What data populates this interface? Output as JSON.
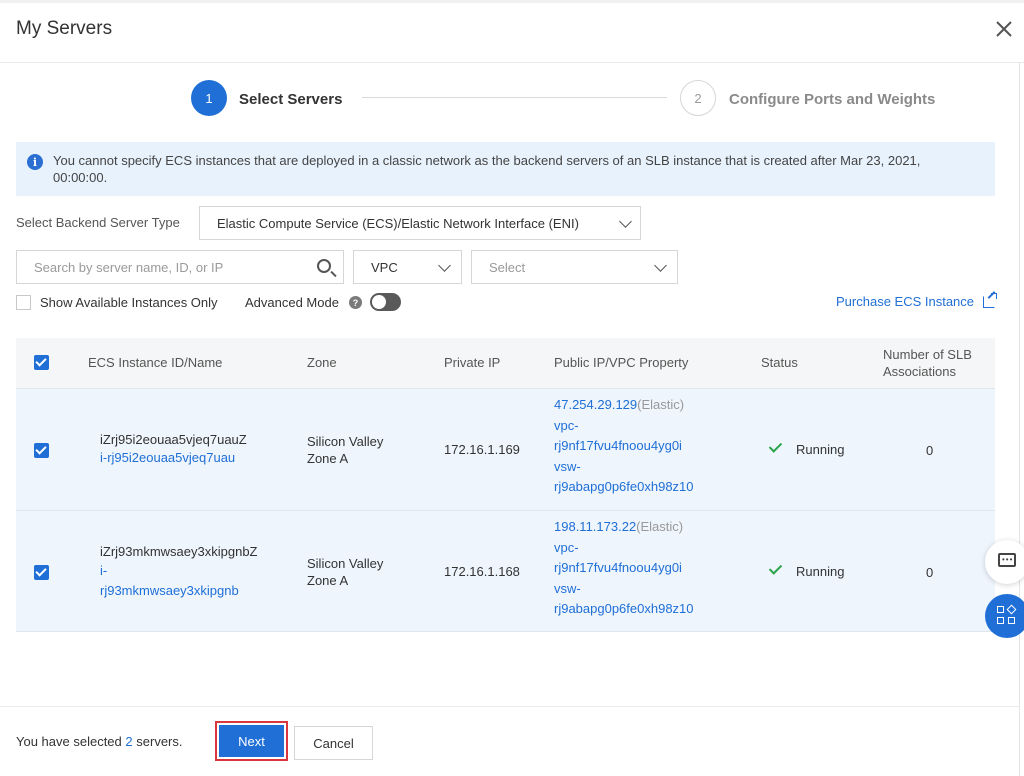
{
  "dialog": {
    "title": "My Servers"
  },
  "steps": [
    {
      "number": "1",
      "label": "Select Servers"
    },
    {
      "number": "2",
      "label": "Configure Ports and Weights"
    }
  ],
  "notice": {
    "text": "You cannot specify ECS instances that are deployed in a classic network as the backend servers of an SLB instance that is created after Mar 23, 2021, 00:00:00."
  },
  "filters": {
    "backend_type_label": "Select Backend Server Type",
    "backend_type_value": "Elastic Compute Service (ECS)/Elastic Network Interface (ENI)",
    "search_placeholder": "Search by server name, ID, or IP",
    "network_value": "VPC",
    "vpc_placeholder": "Select",
    "available_only_label": "Show Available Instances Only",
    "advanced_mode_label": "Advanced Mode",
    "purchase_link": "Purchase ECS Instance"
  },
  "table": {
    "headers": {
      "instance": "ECS Instance ID/Name",
      "zone": "Zone",
      "private_ip": "Private IP",
      "public_ip": "Public IP/VPC Property",
      "status": "Status",
      "slb_line1": "Number of SLB",
      "slb_line2": "Associations"
    },
    "rows": [
      {
        "name": "iZrj95i2eouaa5vjeq7uauZ",
        "id_line1": "i-rj95i2eouaa5vjeq7uau",
        "id_line2": "",
        "zone_line1": "Silicon Valley",
        "zone_line2": "Zone A",
        "private_ip": "172.16.1.169",
        "public_ip": "47.254.29.129",
        "ip_type": "(Elastic)",
        "vpc_prefix": "vpc-",
        "vpc_id": "rj9nf17fvu4fnoou4yg0i",
        "vsw_prefix": "vsw-",
        "vsw_id": "rj9abapg0p6fe0xh98z10",
        "status": "Running",
        "slb_count": "0",
        "checked": true
      },
      {
        "name": "iZrj93mkmwsaey3xkipgnbZ",
        "id_line1": "i-",
        "id_line2": "rj93mkmwsaey3xkipgnb",
        "zone_line1": "Silicon Valley",
        "zone_line2": "Zone A",
        "private_ip": "172.16.1.168",
        "public_ip": "198.11.173.22",
        "ip_type": "(Elastic)",
        "vpc_prefix": "vpc-",
        "vpc_id": "rj9nf17fvu4fnoou4yg0i",
        "vsw_prefix": "vsw-",
        "vsw_id": "rj9abapg0p6fe0xh98z10",
        "status": "Running",
        "slb_count": "0",
        "checked": true
      }
    ]
  },
  "footer": {
    "selected_prefix": "You have selected",
    "selected_count": "2",
    "selected_suffix": "servers.",
    "next_label": "Next",
    "cancel_label": "Cancel"
  },
  "colors": {
    "primary": "#1f6fd6",
    "notice_bg": "#e8f2fd",
    "running": "#2aa34a",
    "highlight_border": "#d9363e"
  }
}
